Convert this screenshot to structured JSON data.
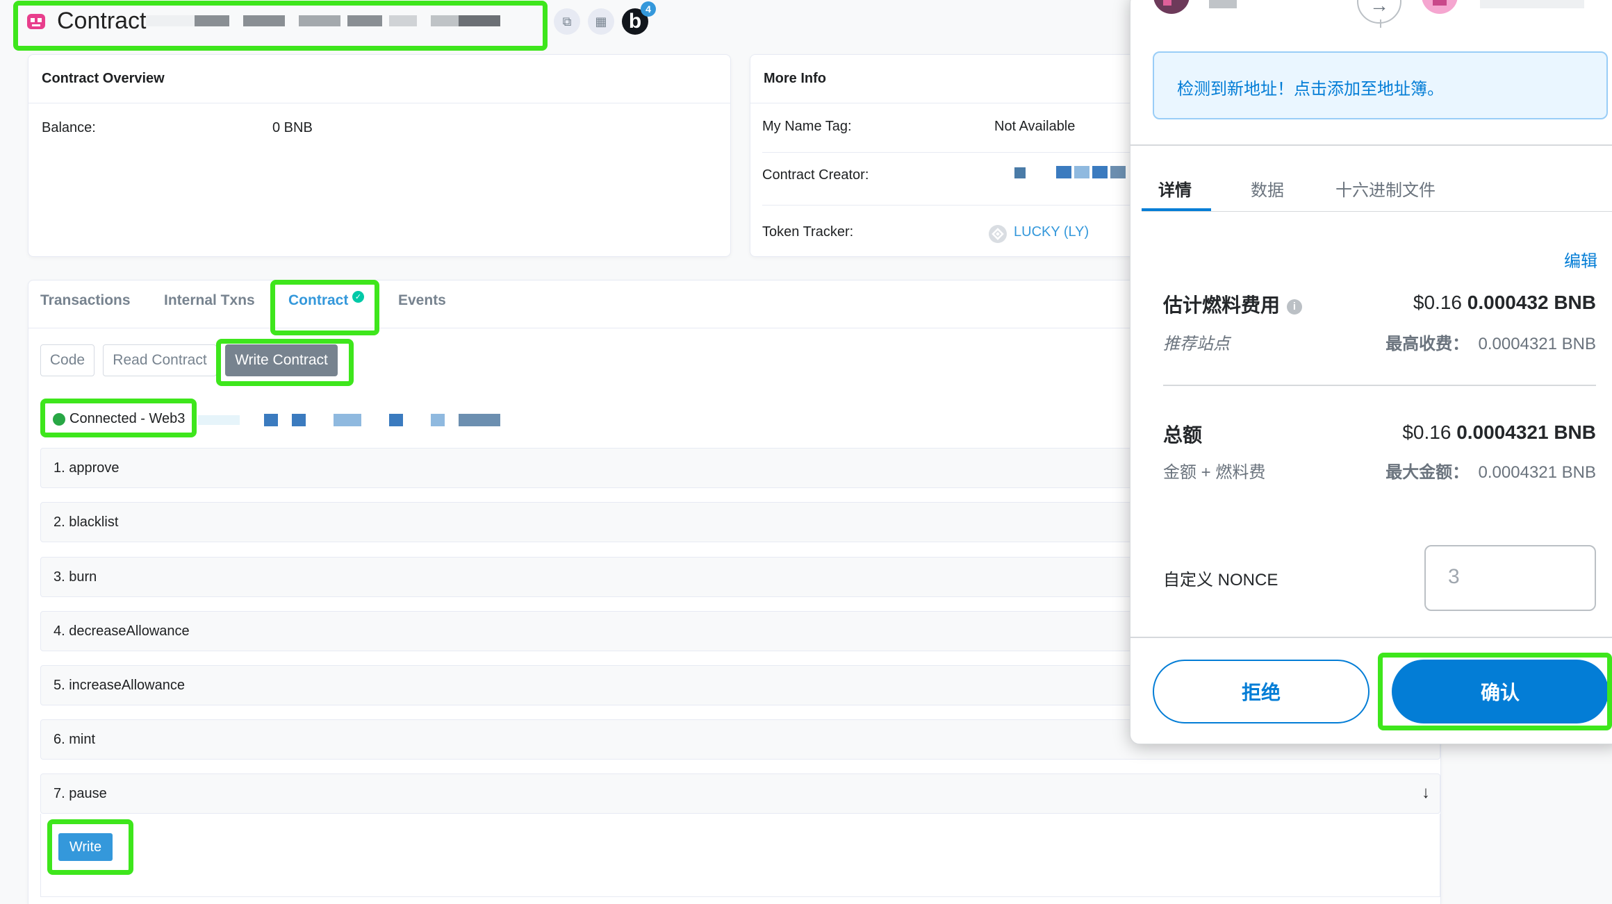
{
  "header": {
    "title": "Contract",
    "badge_letter": "b",
    "badge_count": "4",
    "copy_icon": "copy-icon",
    "qr_icon": "qr-code-icon"
  },
  "overview": {
    "title": "Contract Overview",
    "balance_label": "Balance:",
    "balance_value": "0 BNB"
  },
  "more_info": {
    "title": "More Info",
    "name_tag_label": "My Name Tag:",
    "name_tag_value": "Not Available",
    "creator_label": "Contract Creator:",
    "token_tracker_label": "Token Tracker:",
    "token_tracker_value": "LUCKY (LY)"
  },
  "tabs": [
    {
      "label": "Transactions"
    },
    {
      "label": "Internal Txns"
    },
    {
      "label": "Contract"
    },
    {
      "label": "Events"
    }
  ],
  "contract_tabs": {
    "code": "Code",
    "read": "Read Contract",
    "write": "Write Contract"
  },
  "connection": {
    "status": "Connected - Web3"
  },
  "functions": [
    {
      "label": "1. approve"
    },
    {
      "label": "2. blacklist"
    },
    {
      "label": "3. burn"
    },
    {
      "label": "4. decreaseAllowance"
    },
    {
      "label": "5. increaseAllowance"
    },
    {
      "label": "6. mint"
    },
    {
      "label": "7. pause"
    }
  ],
  "write_button": "Write",
  "expand_icon": "↓",
  "metamask": {
    "notice": "检测到新地址！点击添加至地址簿。",
    "tabs": {
      "details": "详情",
      "data": "数据",
      "hex": "十六进制文件"
    },
    "edit": "编辑",
    "gas_fee_label": "估计燃料费用",
    "gas_fee_fiat": "$0.16",
    "gas_fee_crypto": "0.000432 BNB",
    "recommended_site": "推荐站点",
    "max_fee_label": "最高收费：",
    "max_fee_value": "0.0004321 BNB",
    "total_label": "总额",
    "total_fiat": "$0.16",
    "total_crypto": "0.0004321 BNB",
    "amount_plus_fee": "金额 + 燃料费",
    "max_amount_label": "最大金额：",
    "max_amount_value": "0.0004321 BNB",
    "nonce_label": "自定义 NONCE",
    "nonce_value": "3",
    "reject": "拒绝",
    "confirm": "确认"
  },
  "colors": {
    "highlight": "#3ee61c",
    "link": "#3498db",
    "metamask_blue": "#037dd6",
    "connected_green": "#28a745"
  }
}
